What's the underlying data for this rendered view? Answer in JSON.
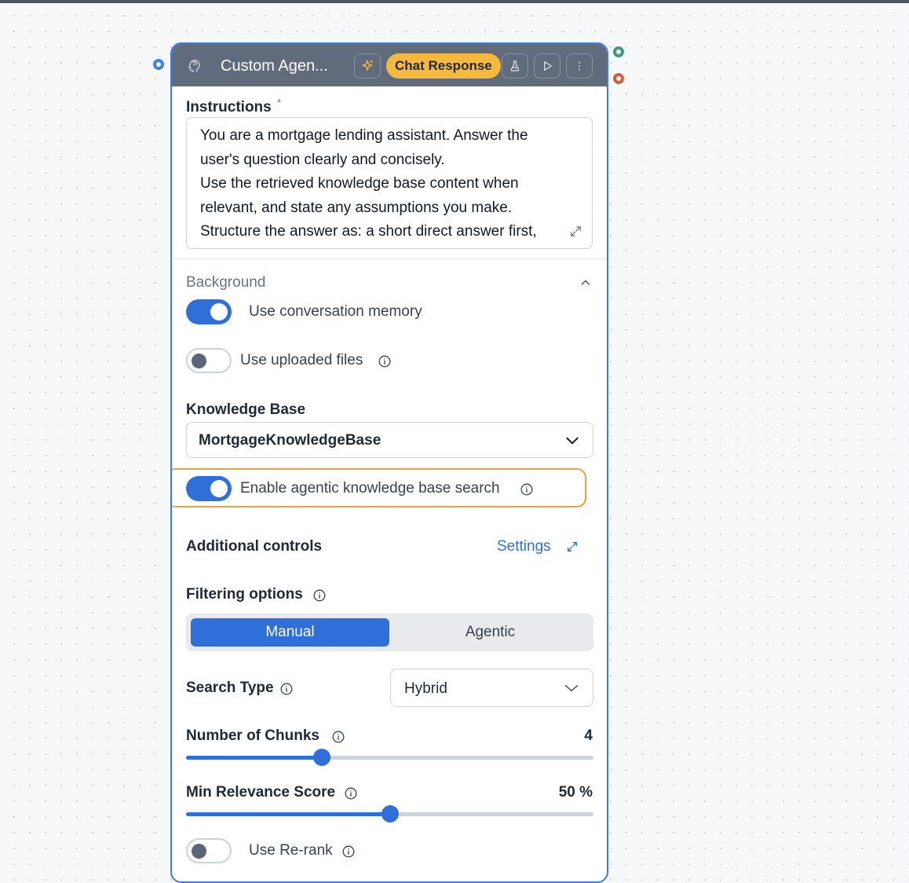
{
  "node": {
    "title": "Custom Agen...",
    "icon": "brain-head-icon",
    "badge": "Chat Response"
  },
  "instructions": {
    "label": "Instructions",
    "required_mark": "*",
    "lines": [
      "You are a mortgage lending assistant. Answer the",
      "user's question clearly and concisely.",
      "Use the retrieved knowledge base content when",
      "relevant, and state any assumptions you make.",
      "Structure the answer as: a short direct answer first,"
    ]
  },
  "background": {
    "title": "Background",
    "memory_label": "Use conversation memory",
    "memory_on": true,
    "files_label": "Use uploaded files",
    "files_on": false
  },
  "knowledge_base": {
    "label": "Knowledge Base",
    "value": "MortgageKnowledgeBase",
    "agentic_label": "Enable agentic knowledge base search",
    "agentic_on": true
  },
  "additional": {
    "label": "Additional controls",
    "settings_link": "Settings"
  },
  "filtering": {
    "label": "Filtering options",
    "options": [
      "Manual",
      "Agentic"
    ],
    "selected": "Manual"
  },
  "search_type": {
    "label": "Search Type",
    "value": "Hybrid"
  },
  "chunks": {
    "label": "Number of Chunks",
    "value": "4",
    "fraction": 0.333
  },
  "relevance": {
    "label": "Min Relevance Score",
    "value": "50 %",
    "fraction": 0.5
  },
  "rerank": {
    "label": "Use Re-rank",
    "on": false
  },
  "colors": {
    "accent": "#2f6fd9",
    "header": "#606b7c",
    "badge": "#f6b93b",
    "highlight": "#f0a040"
  }
}
